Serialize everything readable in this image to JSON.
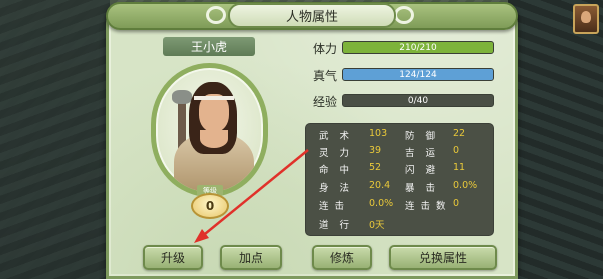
{
  "window": {
    "title": "人物属性"
  },
  "character": {
    "name": "王小虎",
    "level_label": "等级",
    "level": "0"
  },
  "bars": [
    {
      "label": "体力",
      "text": "210/210",
      "fill": 1.0,
      "color": "#7db33a"
    },
    {
      "label": "真气",
      "text": "124/124",
      "fill": 1.0,
      "color": "#5ea0d6"
    },
    {
      "label": "经验",
      "text": "0/40",
      "fill": 0.0,
      "color": "#7db33a"
    }
  ],
  "stats": [
    {
      "n1": "武术",
      "v1": "103",
      "n2": "防御",
      "v2": "22"
    },
    {
      "n1": "灵力",
      "v1": "39",
      "n2": "吉运",
      "v2": "0"
    },
    {
      "n1": "命中",
      "v1": "52",
      "n2": "闪避",
      "v2": "11"
    },
    {
      "n1": "身法",
      "v1": "20.4",
      "n2": "暴击",
      "v2": "0.0%"
    },
    {
      "n1": "连击",
      "v1": "0.0%",
      "n2": "连击数",
      "v2": "0"
    },
    {
      "n1": "道行",
      "v1": "0天",
      "n2": "",
      "v2": ""
    }
  ],
  "buttons": {
    "upgrade": "升级",
    "add_points": "加点",
    "cultivate": "修炼",
    "exchange": "兑换属性"
  },
  "colors": {
    "annotation_arrow": "#e0312a",
    "stat_value": "#e9c93a"
  }
}
